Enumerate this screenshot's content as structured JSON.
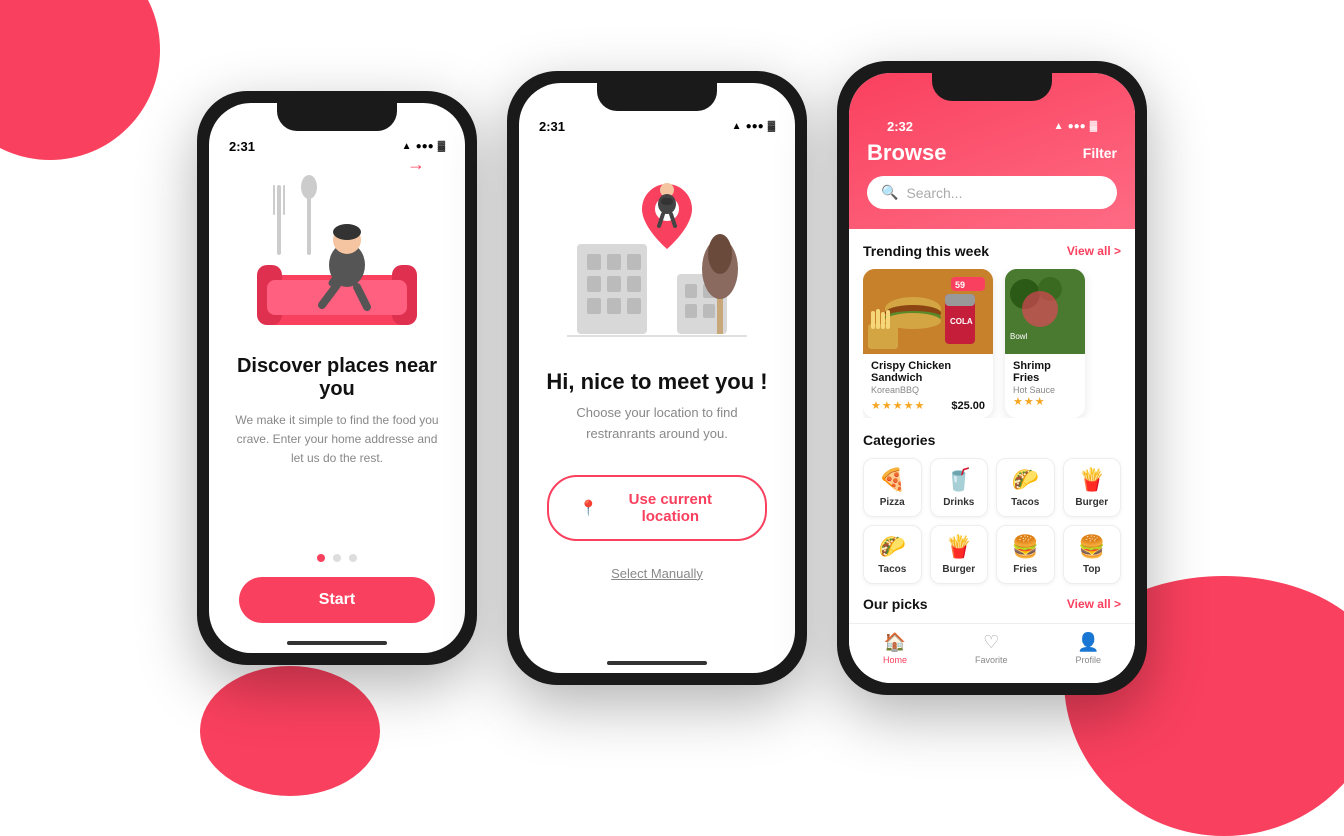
{
  "background": {
    "blob_color": "#f9405e"
  },
  "phone1": {
    "status_time": "2:31",
    "skip_arrow": "→",
    "title": "Discover places near you",
    "subtitle": "We make it simple to find the food you crave. Enter your  home addresse and let us do the rest.",
    "dots": [
      {
        "active": true
      },
      {
        "active": false
      },
      {
        "active": false
      }
    ],
    "start_label": "Start"
  },
  "phone2": {
    "status_time": "2:31",
    "title": "Hi, nice to meet you !",
    "subtitle": "Choose your location to find restranrants around you.",
    "location_btn": "Use current location",
    "select_manually": "Select Manually"
  },
  "phone3": {
    "status_time": "2:32",
    "header_title": "Browse",
    "filter_label": "Filter",
    "search_placeholder": "Search...",
    "trending_title": "Trending this week",
    "view_all_1": "View all >",
    "foods": [
      {
        "name": "Crispy Chicken Sandwich",
        "place": "KoreanBBQ",
        "stars": 5,
        "price": "$25.00",
        "img_type": "burger"
      },
      {
        "name": "Shrimp Fries",
        "place": "Hot Sauce",
        "stars": 3,
        "price": "",
        "img_type": "shrimp"
      }
    ],
    "categories_title": "Categories",
    "categories": [
      {
        "emoji": "🍕",
        "label": "Pizza"
      },
      {
        "emoji": "🥤",
        "label": "Drinks"
      },
      {
        "emoji": "🌮",
        "label": "Tacos"
      },
      {
        "emoji": "🍟",
        "label": "Burger"
      },
      {
        "emoji": "🌮",
        "label": "Tacos"
      },
      {
        "emoji": "🍟",
        "label": "Burger"
      },
      {
        "emoji": "🍔",
        "label": "Fries"
      },
      {
        "emoji": "🍔",
        "label": "Top"
      }
    ],
    "our_picks_title": "Our picks",
    "view_all_2": "View all >",
    "nav": [
      {
        "icon": "🏠",
        "label": "Home",
        "active": true
      },
      {
        "icon": "♡",
        "label": "Favorite",
        "active": false
      },
      {
        "icon": "👤",
        "label": "Profile",
        "active": false
      }
    ]
  }
}
